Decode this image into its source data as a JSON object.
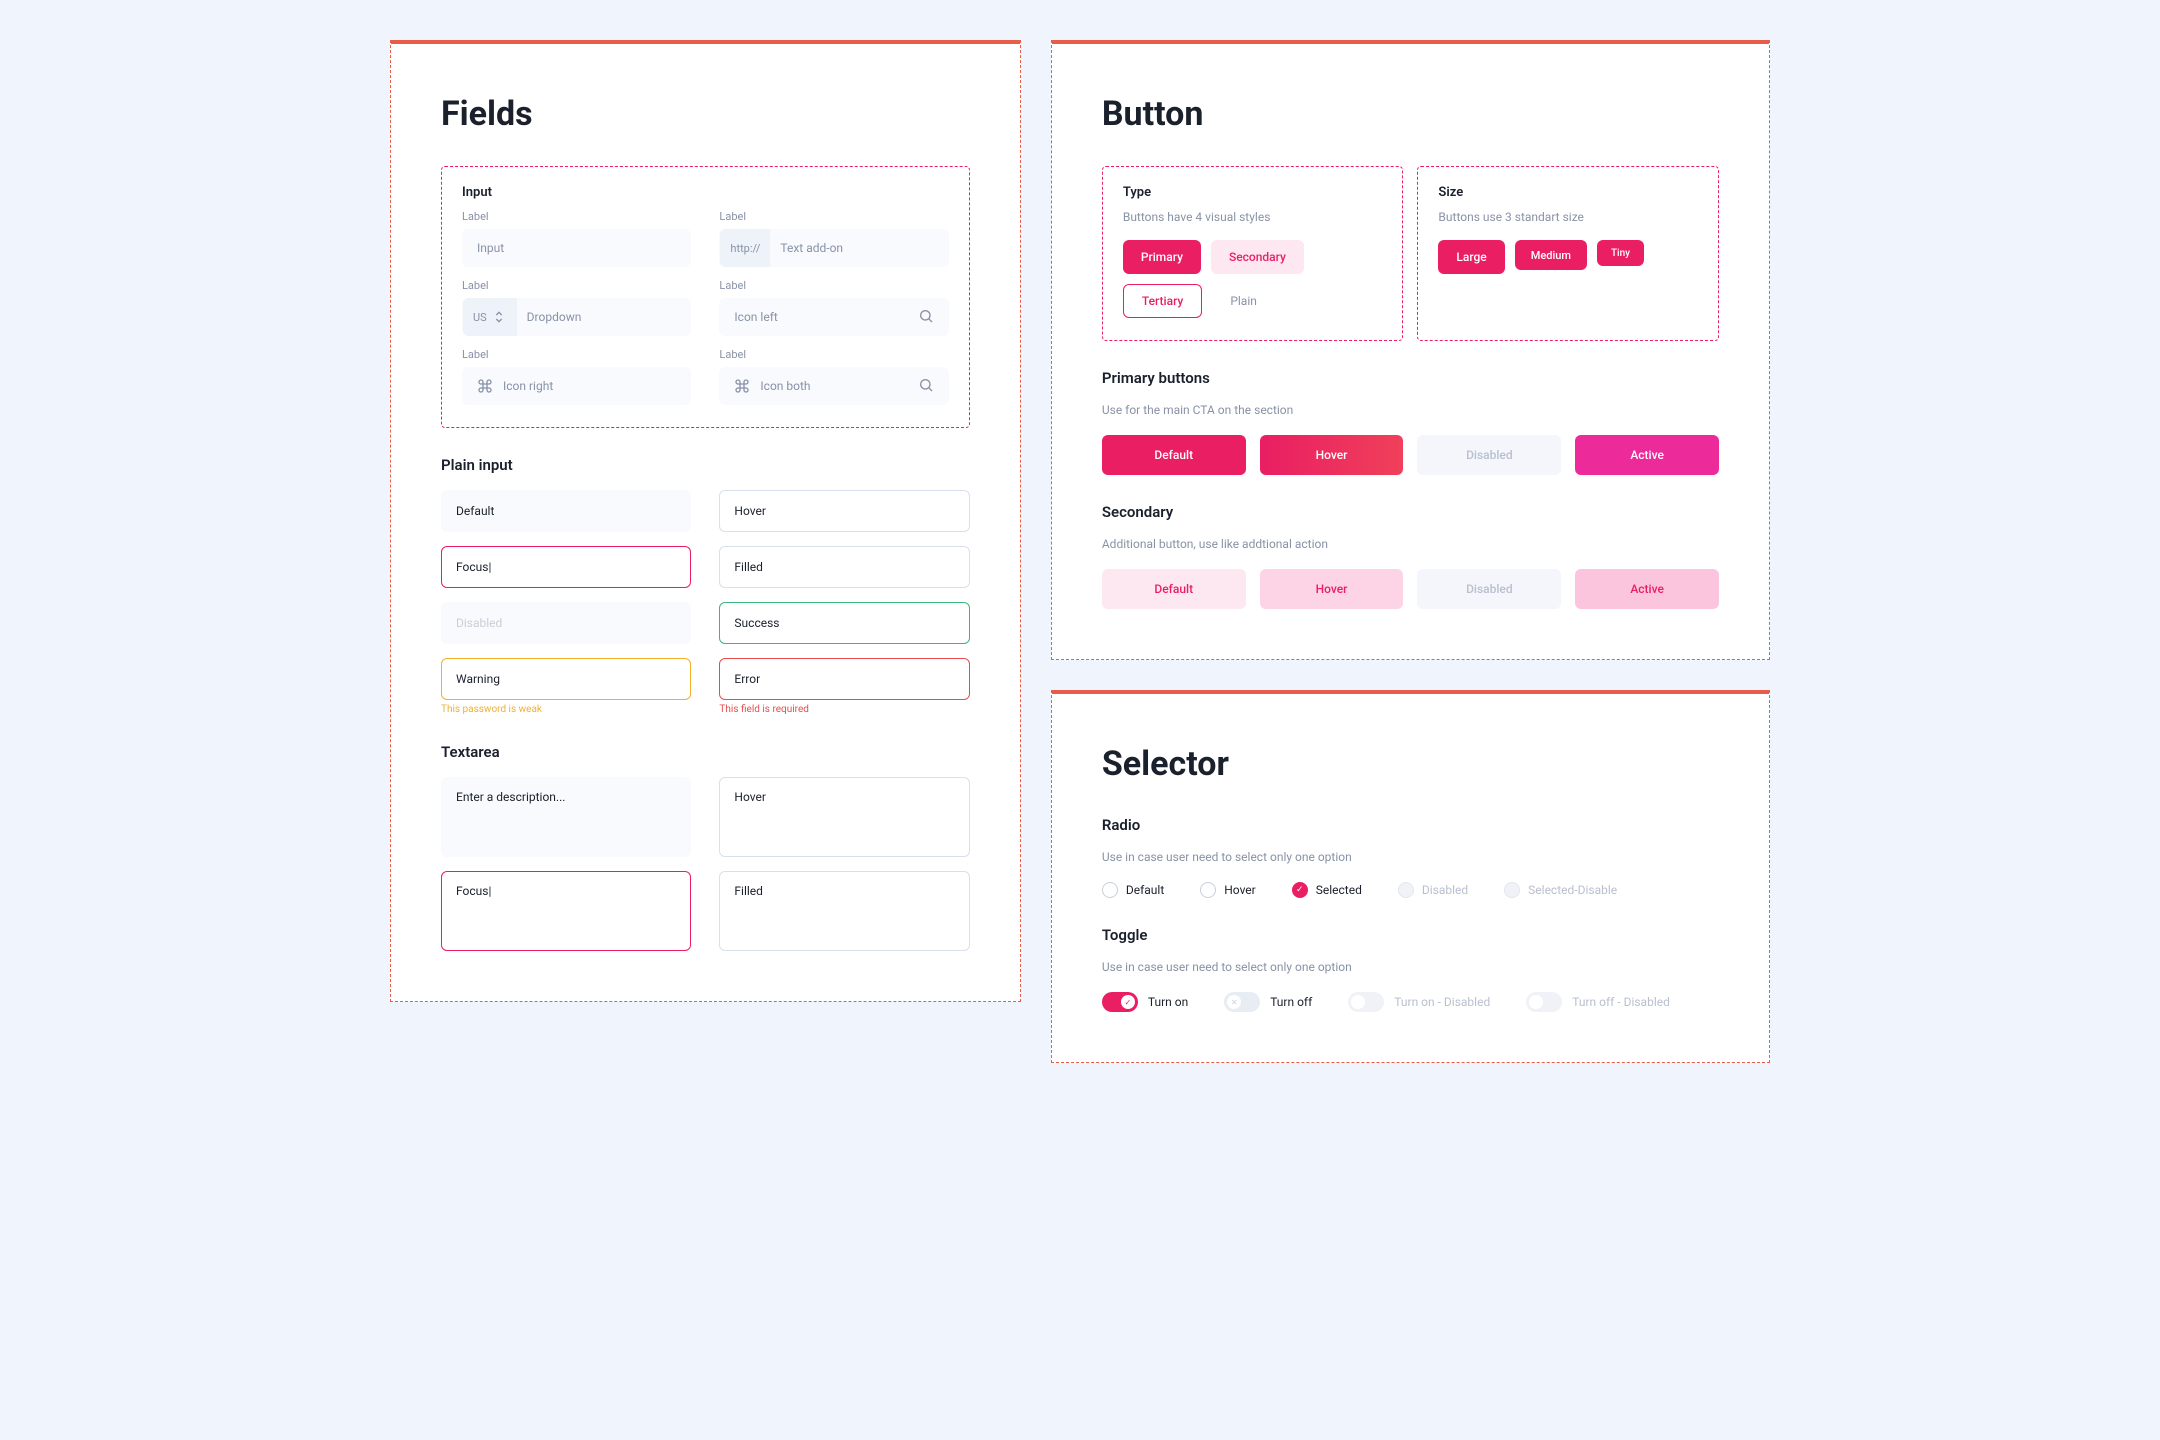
{
  "fields": {
    "title": "Fields",
    "inputGroup": {
      "title": "Input",
      "label": "Label",
      "plain": "Input",
      "addon": {
        "prefix": "http://",
        "placeholder": "Text add-on"
      },
      "dropdown": {
        "prefix": "US",
        "placeholder": "Dropdown"
      },
      "iconLeft": "Icon left",
      "iconRight": "Icon right",
      "iconBoth": "Icon both"
    },
    "plainInput": {
      "title": "Plain input",
      "default": "Default",
      "hover": "Hover",
      "focus": "Focus",
      "filled": "Filled",
      "disabled": "Disabled",
      "success": "Success",
      "warning": "Warning",
      "warningHelp": "This password is weak",
      "error": "Error",
      "errorHelp": "This field is required"
    },
    "textarea": {
      "title": "Textarea",
      "default": "Enter a description...",
      "hover": "Hover",
      "focus": "Focus",
      "filled": "Filled"
    }
  },
  "button": {
    "title": "Button",
    "type": {
      "title": "Type",
      "desc": "Buttons have 4 visual styles",
      "primary": "Primary",
      "secondary": "Secondary",
      "tertiary": "Tertiary",
      "plain": "Plain"
    },
    "size": {
      "title": "Size",
      "desc": "Buttons use 3 standart size",
      "large": "Large",
      "medium": "Medium",
      "tiny": "Tiny"
    },
    "primary": {
      "title": "Primary buttons",
      "desc": "Use for the main CTA on the section",
      "default": "Default",
      "hover": "Hover",
      "disabled": "Disabled",
      "active": "Active"
    },
    "secondary": {
      "title": "Secondary",
      "desc": "Additional button, use like addtional action",
      "default": "Default",
      "hover": "Hover",
      "disabled": "Disabled",
      "active": "Active"
    }
  },
  "selector": {
    "title": "Selector",
    "radio": {
      "title": "Radio",
      "desc": "Use in case user need to select only one option",
      "default": "Default",
      "hover": "Hover",
      "selected": "Selected",
      "disabled": "Disabled",
      "selectedDisabled": "Selected-Disable"
    },
    "toggle": {
      "title": "Toggle",
      "desc": "Use in case user need to select only one option",
      "on": "Turn on",
      "off": "Turn off",
      "onDisabled": "Turn on - Disabled",
      "offDisabled": "Turn off - Disabled"
    }
  }
}
